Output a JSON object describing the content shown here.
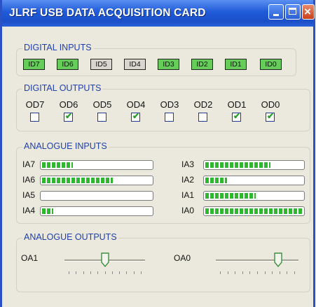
{
  "window": {
    "title": "JLRF USB DATA ACQUISITION CARD"
  },
  "digital_inputs": {
    "title": "DIGITAL INPUTS",
    "leds": [
      {
        "label": "ID7",
        "on": true
      },
      {
        "label": "ID6",
        "on": true
      },
      {
        "label": "ID5",
        "on": false
      },
      {
        "label": "ID4",
        "on": false
      },
      {
        "label": "ID3",
        "on": true
      },
      {
        "label": "ID2",
        "on": true
      },
      {
        "label": "ID1",
        "on": true
      },
      {
        "label": "ID0",
        "on": true
      }
    ]
  },
  "digital_outputs": {
    "title": "DIGITAL OUTPUTS",
    "items": [
      {
        "label": "OD7",
        "checked": false
      },
      {
        "label": "OD6",
        "checked": true
      },
      {
        "label": "OD5",
        "checked": false
      },
      {
        "label": "OD4",
        "checked": true
      },
      {
        "label": "OD3",
        "checked": false
      },
      {
        "label": "OD2",
        "checked": false
      },
      {
        "label": "OD1",
        "checked": true
      },
      {
        "label": "OD0",
        "checked": true
      }
    ]
  },
  "analogue_inputs": {
    "title": "ANALOGUE INPUTS",
    "channels": [
      {
        "label": "IA7",
        "level": 0.28
      },
      {
        "label": "IA6",
        "level": 0.65
      },
      {
        "label": "IA5",
        "level": 0
      },
      {
        "label": "IA4",
        "level": 0.1
      },
      {
        "label": "IA3",
        "level": 0.67
      },
      {
        "label": "IA2",
        "level": 0.22
      },
      {
        "label": "IA1",
        "level": 0.52
      },
      {
        "label": "IA0",
        "level": 1.0
      }
    ]
  },
  "analogue_outputs": {
    "title": "ANALOGUE OUTPUTS",
    "channels": [
      {
        "label": "OA1",
        "value": 0.5
      },
      {
        "label": "OA0",
        "value": 0.75
      }
    ]
  }
}
